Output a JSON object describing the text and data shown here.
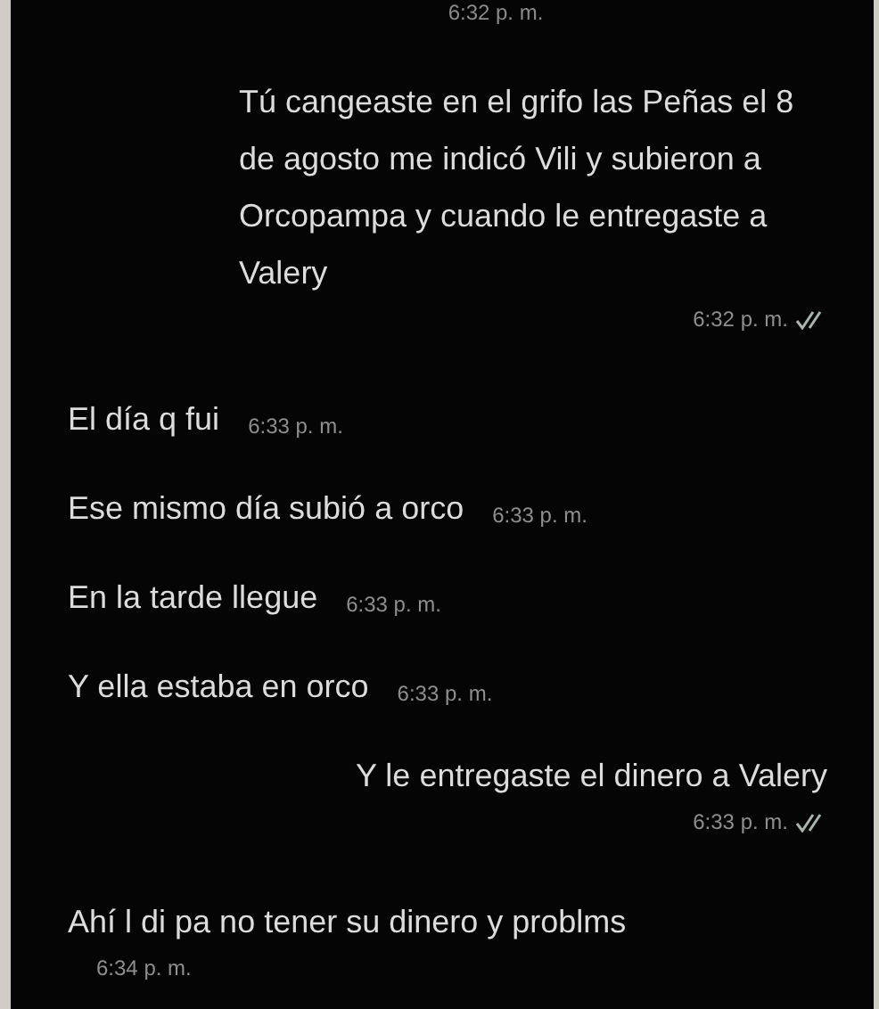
{
  "top_time": "6:32 p. m.",
  "messages": [
    {
      "kind": "sent",
      "text": "Tú cangeaste en el grifo las Peñas el 8 de agosto me indicó Vili y subieron a Orcopampa y cuando le entregaste a Valery",
      "time": "6:32 p. m.",
      "read": true
    },
    {
      "kind": "received",
      "text": "El día q fui",
      "time": "6:33 p. m."
    },
    {
      "kind": "received",
      "text": "Ese mismo día subió a orco",
      "time": "6:33 p. m."
    },
    {
      "kind": "received",
      "text": "En la tarde llegue",
      "time": "6:33 p. m."
    },
    {
      "kind": "received",
      "text": "Y ella estaba en orco",
      "time": "6:33 p. m."
    },
    {
      "kind": "sent",
      "text": "Y le entregaste el dinero a Valery",
      "time": "6:33 p. m.",
      "read": true
    },
    {
      "kind": "received",
      "text": "Ahí l di pa no tener su dinero y problms",
      "time": "6:34 p. m."
    }
  ]
}
